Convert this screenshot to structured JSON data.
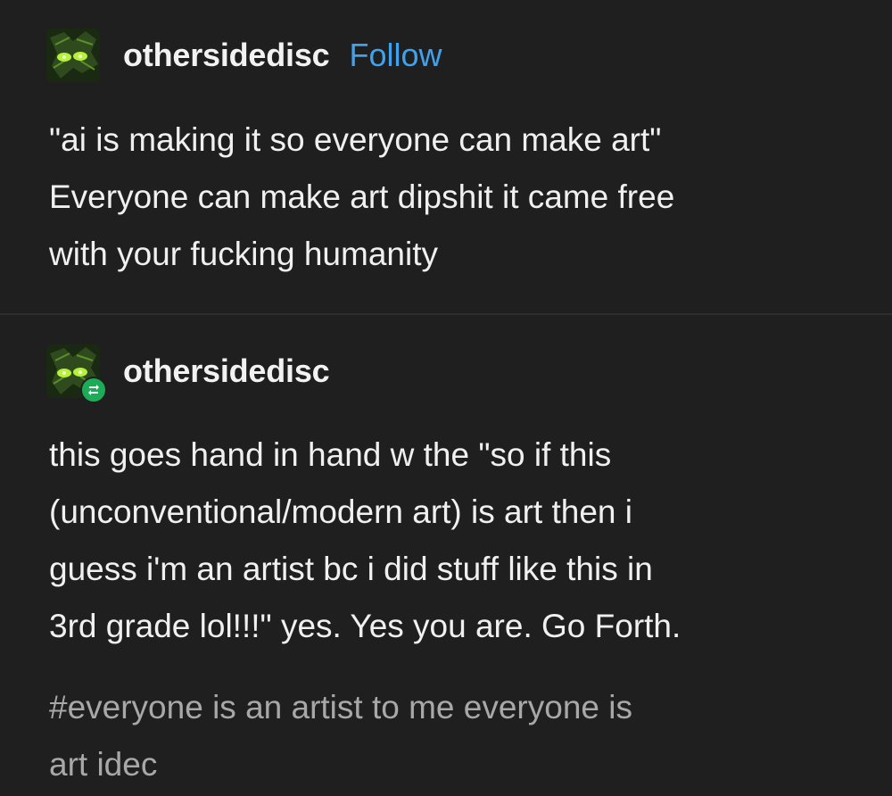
{
  "colors": {
    "background": "#1f1f1f",
    "text": "#f0f0f0",
    "follow_link": "#3fa2ef",
    "tags": "#a8a8a8",
    "reblog_badge": "#1cab57"
  },
  "original_post": {
    "username": "othersidedisc",
    "follow_label": "Follow",
    "avatar_icon": "green-eyes-avatar-icon",
    "body_lines": [
      "\"ai is making it so everyone can make art\"",
      "Everyone can make art dipshit it came free",
      "with your fucking humanity"
    ]
  },
  "reblog": {
    "username": "othersidedisc",
    "avatar_icon": "green-eyes-avatar-icon",
    "badge_icon": "reblog-icon",
    "body_lines": [
      "this goes hand in hand w the \"so if this",
      "(unconventional/modern art) is art then i",
      "guess i'm an artist bc i did stuff like this in",
      "3rd grade lol!!!\" yes. Yes you are. Go Forth."
    ],
    "tag_lines": [
      "#everyone is an artist to me everyone is",
      "art idec"
    ]
  }
}
